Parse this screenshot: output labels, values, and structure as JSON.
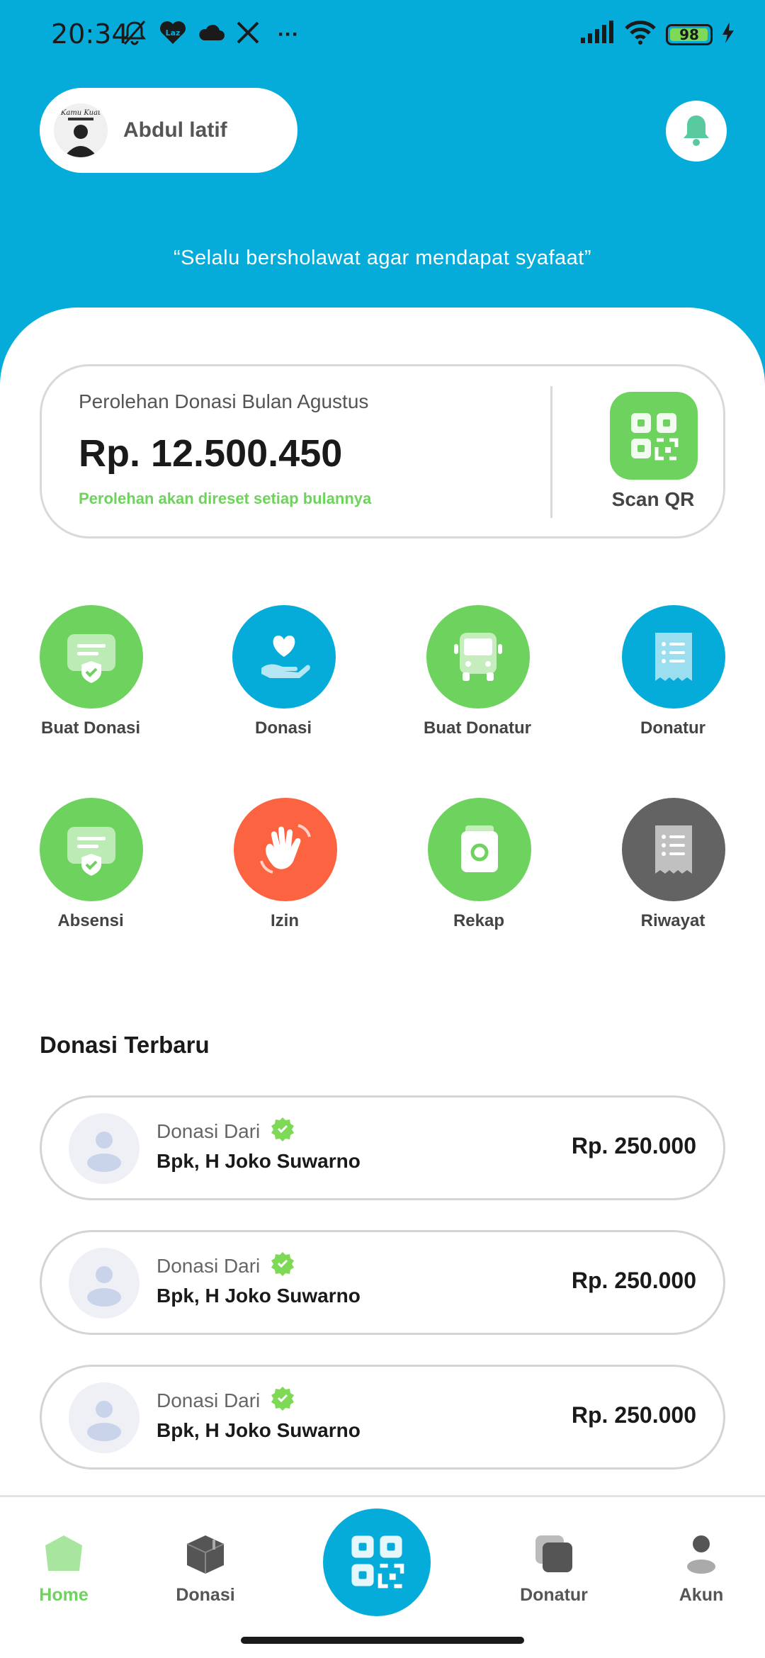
{
  "status_bar": {
    "time": "20:34",
    "battery": "98",
    "battery_level": 0.98,
    "more": "···",
    "app_badge": "Laz"
  },
  "profile": {
    "name": "Abdul latif",
    "avatar_caption": "Kamu Kuat"
  },
  "quote": "“Selalu bersholawat agar mendapat syafaat”",
  "donation_summary": {
    "label": "Perolehan Donasi Bulan Agustus",
    "amount": "Rp. 12.500.450",
    "note": "Perolehan akan direset setiap bulannya",
    "scan_label": "Scan QR"
  },
  "menu": [
    {
      "label": "Buat Donasi",
      "icon": "donation-form-icon",
      "color": "#6ed25e"
    },
    {
      "label": "Donasi",
      "icon": "heart-hand-icon",
      "color": "#06acd9"
    },
    {
      "label": "Buat Donatur",
      "icon": "bus-icon",
      "color": "#6ed25e"
    },
    {
      "label": "Donatur",
      "icon": "receipt-icon",
      "color": "#06acd9"
    },
    {
      "label": "Absensi",
      "icon": "attendance-icon",
      "color": "#6ed25e"
    },
    {
      "label": "Izin",
      "icon": "waving-hand-icon",
      "color": "#fb6341"
    },
    {
      "label": "Rekap",
      "icon": "wallet-icon",
      "color": "#6ed25e"
    },
    {
      "label": "Riwayat",
      "icon": "history-receipt-icon",
      "color": "#636363"
    }
  ],
  "recent": {
    "title": "Donasi Terbaru",
    "items": [
      {
        "from": "Donasi Dari",
        "name": "Bpk, H Joko Suwarno",
        "amount": "Rp. 250.000"
      },
      {
        "from": "Donasi Dari",
        "name": "Bpk, H Joko Suwarno",
        "amount": "Rp. 250.000"
      },
      {
        "from": "Donasi Dari",
        "name": "Bpk, H Joko Suwarno",
        "amount": "Rp. 250.000"
      }
    ]
  },
  "bottom_nav": {
    "home": "Home",
    "donasi": "Donasi",
    "donatur": "Donatur",
    "akun": "Akun"
  },
  "colors": {
    "primary": "#06acd9",
    "green": "#6ed25e",
    "orange": "#fb6341",
    "gray": "#636363"
  }
}
